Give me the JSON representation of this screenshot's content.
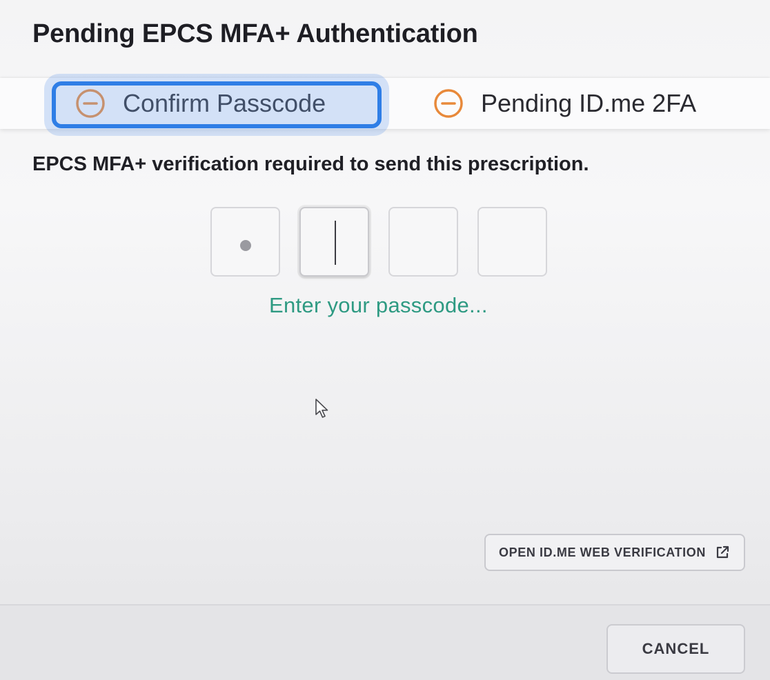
{
  "dialog": {
    "title": "Pending EPCS MFA+ Authentication"
  },
  "steps": [
    {
      "label": "Confirm Passcode",
      "icon": "minus-circle-icon",
      "status": "pending",
      "focused": true
    },
    {
      "label": "Pending ID.me 2FA",
      "icon": "minus-circle-icon",
      "status": "pending",
      "focused": false
    }
  ],
  "instruction": "EPCS MFA+ verification required to send this prescription.",
  "passcode": {
    "length": 4,
    "filled": 1,
    "active_index": 1,
    "hint": "Enter your passcode..."
  },
  "buttons": {
    "open_idme": {
      "label": "OPEN ID.ME WEB VERIFICATION",
      "icon": "external-link-icon"
    },
    "cancel": {
      "label": "CANCEL"
    }
  },
  "colors": {
    "pending_icon": "#e8893a",
    "focus_ring": "#2f7ee6",
    "hint_text": "#2e9a82"
  }
}
